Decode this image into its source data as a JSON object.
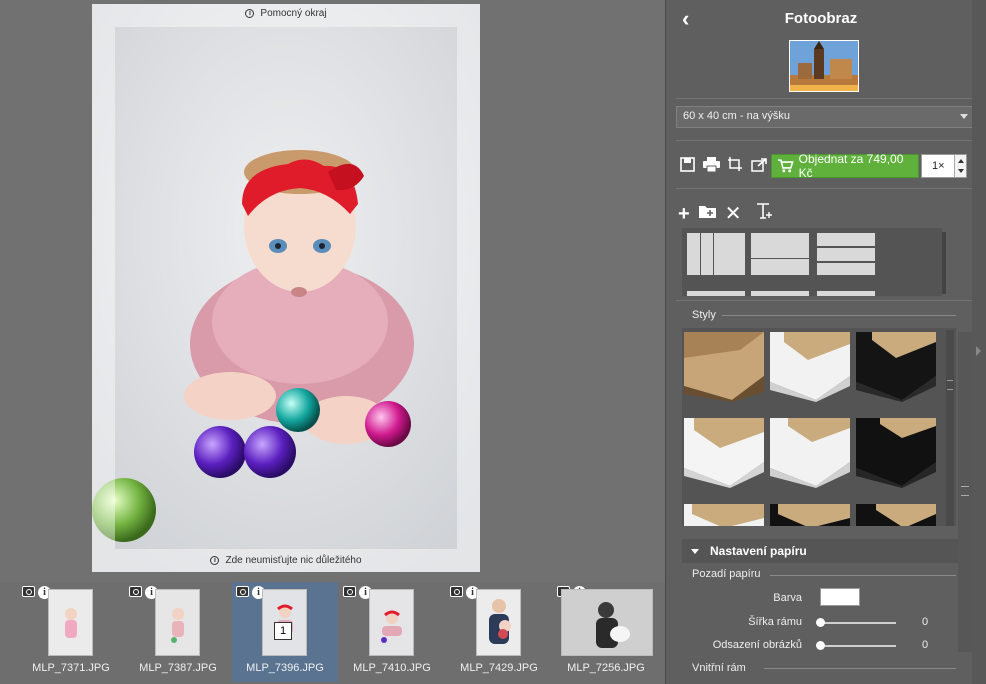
{
  "canvas": {
    "hint_top": "Pomocný okraj",
    "hint_bottom": "Zde neumisťujte nic důležitého"
  },
  "filmstrip": {
    "items": [
      {
        "name": "MLP_7371.JPG",
        "selected": false
      },
      {
        "name": "MLP_7387.JPG",
        "selected": false
      },
      {
        "name": "MLP_7396.JPG",
        "selected": true,
        "badge": "1"
      },
      {
        "name": "MLP_7410.JPG",
        "selected": false
      },
      {
        "name": "MLP_7429.JPG",
        "selected": false
      },
      {
        "name": "MLP_7256.JPG",
        "selected": false
      }
    ]
  },
  "panel": {
    "title": "Fotoobraz",
    "size_select": {
      "value": "60 x 40 cm - na výšku"
    },
    "order_button": "Objednat za 749,00 Kč",
    "quantity": "1×",
    "styles_label": "Styly",
    "paper_section": "Nastavení papíru",
    "background_label": "Pozadí papíru",
    "color_label": "Barva",
    "color_value": "#ffffff",
    "frame_width_label": "Šířka rámu",
    "frame_width_value": "0",
    "spacing_label": "Odsazení obrázků",
    "spacing_value": "0",
    "inner_frame_label": "Vnitřní rám"
  },
  "colors": {
    "accent_green": "#5fb13b",
    "selected_thumb": "#5a7390",
    "panel_bg": "#5f5f5f"
  },
  "icons": [
    "back-icon",
    "save-icon",
    "print-icon",
    "crop-icon",
    "share-icon",
    "cart-icon",
    "add-icon",
    "add-folder-icon",
    "delete-icon",
    "text-icon",
    "camera-icon",
    "info-icon"
  ]
}
